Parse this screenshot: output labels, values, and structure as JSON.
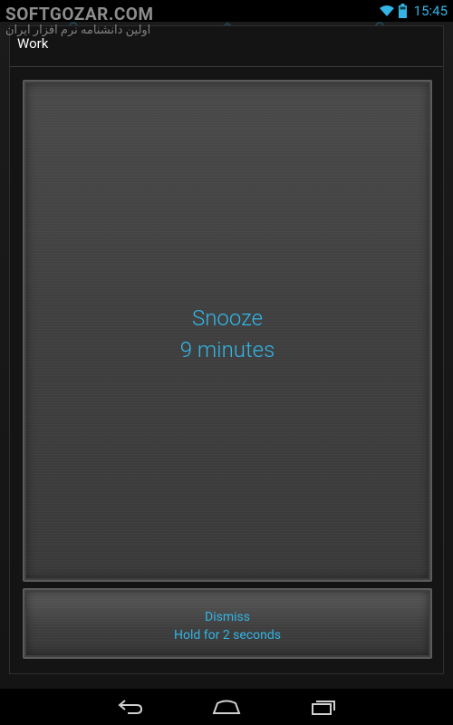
{
  "status_bar": {
    "time": "15:45",
    "icons": [
      "wifi-icon",
      "battery-icon"
    ]
  },
  "watermark": {
    "main": "SOFTGOZAR.COM",
    "sub": "اولین دانشنامه نرم افزار ایران"
  },
  "dialog": {
    "title": "Work"
  },
  "snooze": {
    "label": "Snooze",
    "duration": "9 minutes"
  },
  "dismiss": {
    "label": "Dismiss",
    "hint": "Hold for 2 seconds"
  },
  "nav_bar": {
    "buttons": [
      "back-icon",
      "home-icon",
      "recent-apps-icon"
    ]
  },
  "colors": {
    "accent": "#33b5e5",
    "background": "#141414",
    "panel": "#424242"
  }
}
